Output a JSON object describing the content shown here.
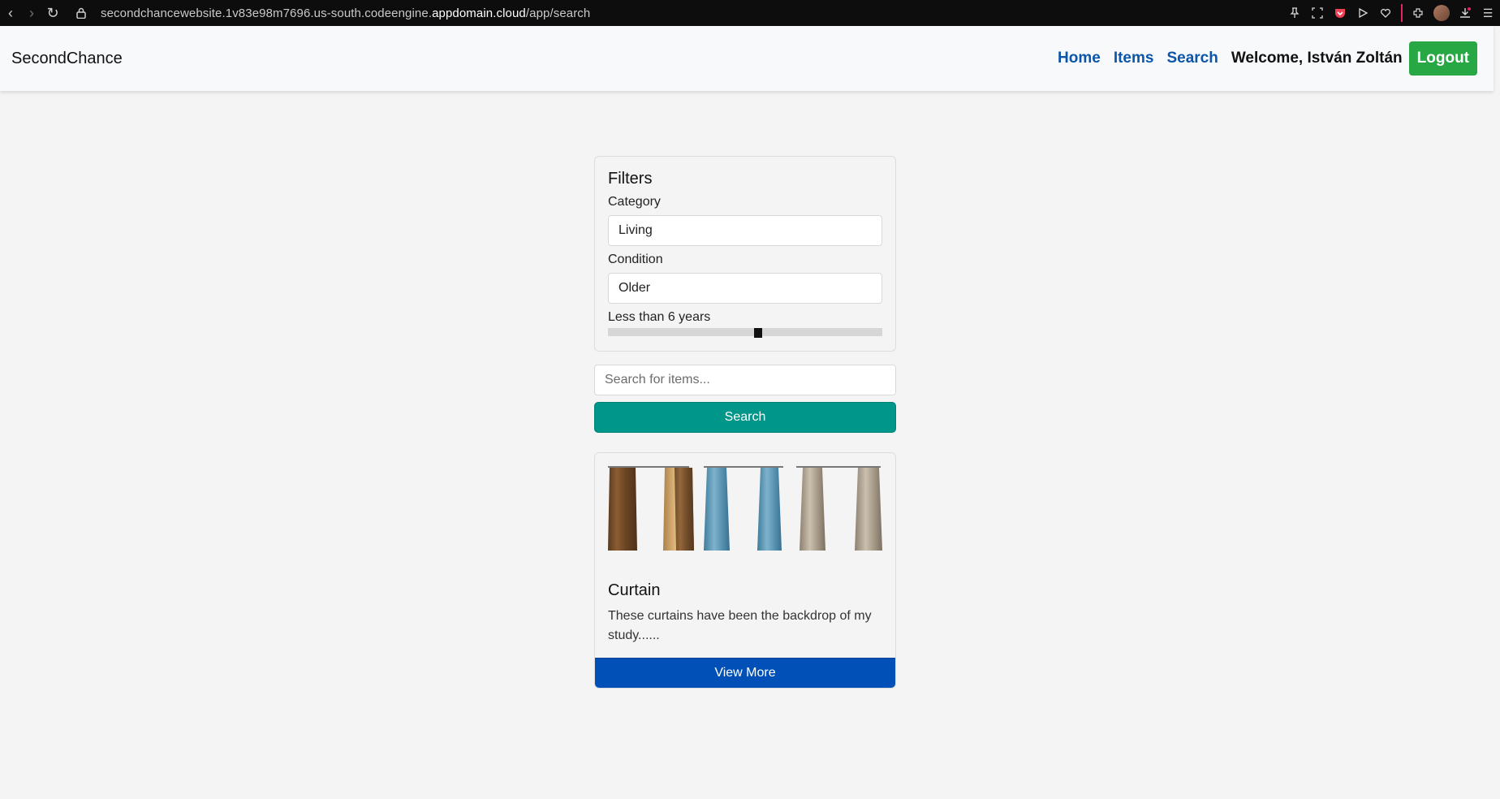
{
  "browser": {
    "url_prefix": "secondchancewebsite.1v83e98m7696.us-south.codeengine.",
    "url_domain": "appdomain.cloud",
    "url_path": "/app/search"
  },
  "navbar": {
    "brand": "SecondChance",
    "links": [
      "Home",
      "Items",
      "Search"
    ],
    "welcome": "Welcome, István Zoltán",
    "logout_label": "Logout"
  },
  "filters": {
    "title": "Filters",
    "category_label": "Category",
    "category_value": "Living",
    "condition_label": "Condition",
    "condition_value": "Older",
    "age_label": "Less than 6 years",
    "age_value": 6,
    "age_fraction": 0.55
  },
  "search": {
    "placeholder": "Search for items...",
    "button_label": "Search"
  },
  "results": [
    {
      "title": "Curtain",
      "description": "These curtains have been the backdrop of my study......",
      "button_label": "View More",
      "image": "curtain-panels"
    }
  ],
  "colors": {
    "link": "#0b56a8",
    "logout": "#28a745",
    "search_button": "#00968a",
    "view_more_button": "#0050b8"
  }
}
